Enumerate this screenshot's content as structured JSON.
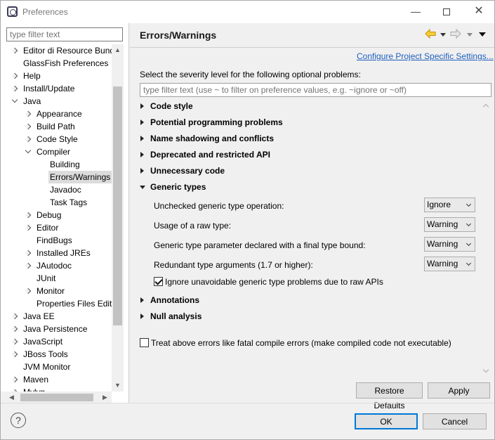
{
  "window": {
    "title": "Preferences",
    "minimize_glyph": "—",
    "close_glyph": "✕"
  },
  "left": {
    "filter_placeholder": "type filter text",
    "tree": [
      {
        "label": "Editor di Resource Bund",
        "level": 0,
        "twisty": "right"
      },
      {
        "label": "GlassFish Preferences",
        "level": 0,
        "twisty": "none"
      },
      {
        "label": "Help",
        "level": 0,
        "twisty": "right"
      },
      {
        "label": "Install/Update",
        "level": 0,
        "twisty": "right"
      },
      {
        "label": "Java",
        "level": 0,
        "twisty": "down"
      },
      {
        "label": "Appearance",
        "level": 1,
        "twisty": "right"
      },
      {
        "label": "Build Path",
        "level": 1,
        "twisty": "right"
      },
      {
        "label": "Code Style",
        "level": 1,
        "twisty": "right"
      },
      {
        "label": "Compiler",
        "level": 1,
        "twisty": "down"
      },
      {
        "label": "Building",
        "level": 2,
        "twisty": "none"
      },
      {
        "label": "Errors/Warnings",
        "level": 2,
        "twisty": "none",
        "selected": true
      },
      {
        "label": "Javadoc",
        "level": 2,
        "twisty": "none"
      },
      {
        "label": "Task Tags",
        "level": 2,
        "twisty": "none"
      },
      {
        "label": "Debug",
        "level": 1,
        "twisty": "right"
      },
      {
        "label": "Editor",
        "level": 1,
        "twisty": "right"
      },
      {
        "label": "FindBugs",
        "level": 1,
        "twisty": "none"
      },
      {
        "label": "Installed JREs",
        "level": 1,
        "twisty": "right"
      },
      {
        "label": "JAutodoc",
        "level": 1,
        "twisty": "right"
      },
      {
        "label": "JUnit",
        "level": 1,
        "twisty": "none"
      },
      {
        "label": "Monitor",
        "level": 1,
        "twisty": "right"
      },
      {
        "label": "Properties Files Edito",
        "level": 1,
        "twisty": "none"
      },
      {
        "label": "Java EE",
        "level": 0,
        "twisty": "right"
      },
      {
        "label": "Java Persistence",
        "level": 0,
        "twisty": "right"
      },
      {
        "label": "JavaScript",
        "level": 0,
        "twisty": "right"
      },
      {
        "label": "JBoss Tools",
        "level": 0,
        "twisty": "right"
      },
      {
        "label": "JVM Monitor",
        "level": 0,
        "twisty": "none"
      },
      {
        "label": "Maven",
        "level": 0,
        "twisty": "right"
      },
      {
        "label": "Mylyn",
        "level": 0,
        "twisty": "right"
      }
    ]
  },
  "right": {
    "title": "Errors/Warnings",
    "configure_link": "Configure Project Specific Settings...",
    "prompt": "Select the severity level for the following optional problems:",
    "filter_placeholder": "type filter text (use ~ to filter on preference values, e.g. ~ignore or ~off)",
    "sections": [
      {
        "label": "Code style",
        "expanded": false
      },
      {
        "label": "Potential programming problems",
        "expanded": false
      },
      {
        "label": "Name shadowing and conflicts",
        "expanded": false
      },
      {
        "label": "Deprecated and restricted API",
        "expanded": false
      },
      {
        "label": "Unnecessary code",
        "expanded": false
      },
      {
        "label": "Generic types",
        "expanded": true
      },
      {
        "label": "Annotations",
        "expanded": false
      },
      {
        "label": "Null analysis",
        "expanded": false
      }
    ],
    "generic_options": [
      {
        "label": "Unchecked generic type operation:",
        "value": "Ignore"
      },
      {
        "label": "Usage of a raw type:",
        "value": "Warning"
      },
      {
        "label": "Generic type parameter declared with a final type bound:",
        "value": "Warning"
      },
      {
        "label": "Redundant type arguments (1.7 or higher):",
        "value": "Warning"
      }
    ],
    "ignore_unavoidable": {
      "label": "Ignore unavoidable generic type problems due to raw APIs",
      "checked": true
    },
    "treat_fatal": {
      "label": "Treat above errors like fatal compile errors (make compiled code not executable)",
      "checked": false
    },
    "restore_defaults": "Restore Defaults",
    "apply": "Apply"
  },
  "footer": {
    "help": "?",
    "ok": "OK",
    "cancel": "Cancel"
  },
  "colors": {
    "link": "#1f5fbf",
    "nav_arrow": "#e8b000",
    "default_button_border": "#0078d7"
  }
}
